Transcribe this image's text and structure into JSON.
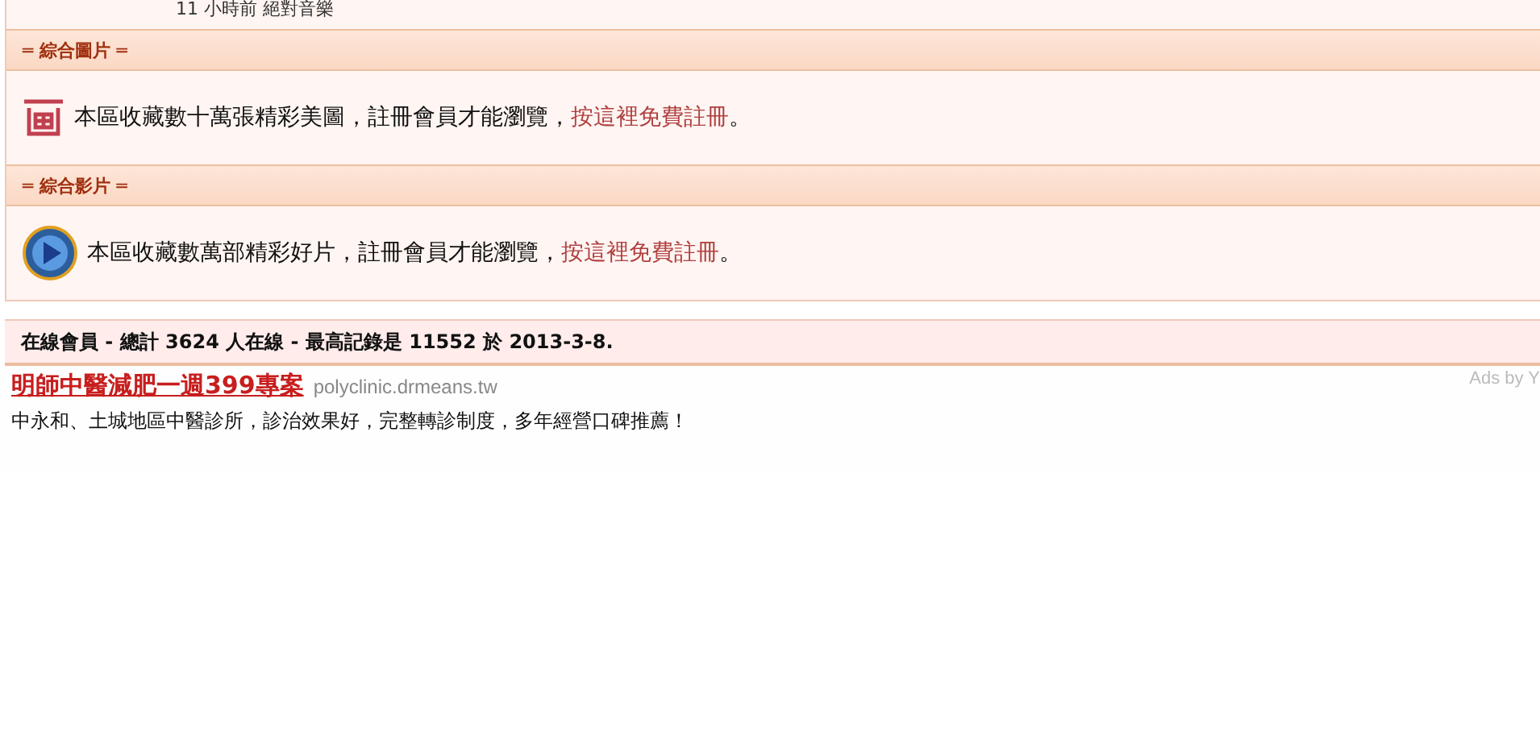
{
  "top_entry": "11 小時前 絕對音樂",
  "sections": [
    {
      "title": "═ 綜合圖片 ═",
      "kind": "image",
      "text": "本區收藏數十萬張精彩美圖，註冊會員才能瀏覽，",
      "link": "按這裡免費註冊",
      "end": "。"
    },
    {
      "title": "═ 綜合影片 ═",
      "kind": "video",
      "text": "本區收藏數萬部精彩好片，註冊會員才能瀏覽，",
      "link": "按這裡免費註冊",
      "end": "。"
    }
  ],
  "online": "在線會員 - 總計 3624 人在線 - 最高記錄是 11552 於 2013-3-8.",
  "ads_label": "Ads by Y",
  "ads": [
    {
      "title": "明師中醫減肥一週399專案",
      "url": "polyclinic.drmeans.tw",
      "desc": "中永和、土城地區中醫診所，診治效果好，完整轉診制度，多年經營口碑推薦！"
    }
  ]
}
